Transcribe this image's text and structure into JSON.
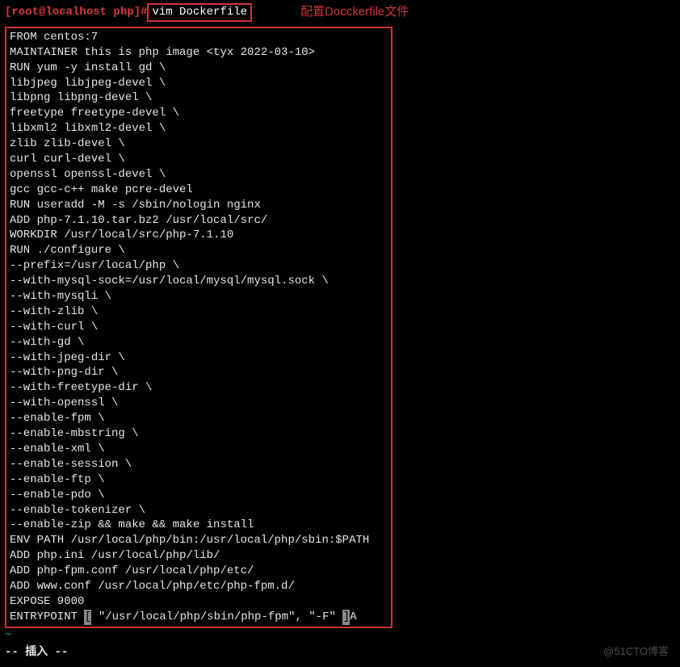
{
  "prompt": {
    "user_host": "[root@localhost php]",
    "hash": "#",
    "command": "vim Dockerfile  "
  },
  "annotation": "配置Docckerfile文件",
  "file_lines": [
    "FROM centos:7",
    "MAINTAINER this is php image <tyx 2022-03-10>",
    "RUN yum -y install gd \\",
    "libjpeg libjpeg-devel \\",
    "libpng libpng-devel \\",
    "freetype freetype-devel \\",
    "libxml2 libxml2-devel \\",
    "zlib zlib-devel \\",
    "curl curl-devel \\",
    "openssl openssl-devel \\",
    "gcc gcc-c++ make pcre-devel",
    "RUN useradd -M -s /sbin/nologin nginx",
    "ADD php-7.1.10.tar.bz2 /usr/local/src/",
    "WORKDIR /usr/local/src/php-7.1.10",
    "RUN ./configure \\",
    "--prefix=/usr/local/php \\",
    "--with-mysql-sock=/usr/local/mysql/mysql.sock \\",
    "--with-mysqli \\",
    "--with-zlib \\",
    "--with-curl \\",
    "--with-gd \\",
    "--with-jpeg-dir \\",
    "--with-png-dir \\",
    "--with-freetype-dir \\",
    "--with-openssl \\",
    "--enable-fpm \\",
    "--enable-mbstring \\",
    "--enable-xml \\",
    "--enable-session \\",
    "--enable-ftp \\",
    "--enable-pdo \\",
    "--enable-tokenizer \\",
    "--enable-zip && make && make install",
    "ENV PATH /usr/local/php/bin:/usr/local/php/sbin:$PATH",
    "ADD php.ini /usr/local/php/lib/",
    "ADD php-fpm.conf /usr/local/php/etc/",
    "ADD www.conf /usr/local/php/etc/php-fpm.d/",
    "EXPOSE 9000"
  ],
  "entrypoint_parts": {
    "prefix": "ENTRYPOINT ",
    "bracket_open": "[",
    "middle": " \"/usr/local/php/sbin/php-fpm\", \"-F\" ",
    "bracket_close": "]",
    "suffix": "A"
  },
  "tilde": "~",
  "mode_line": "-- 插入 --",
  "watermark": "@51CTO博客"
}
